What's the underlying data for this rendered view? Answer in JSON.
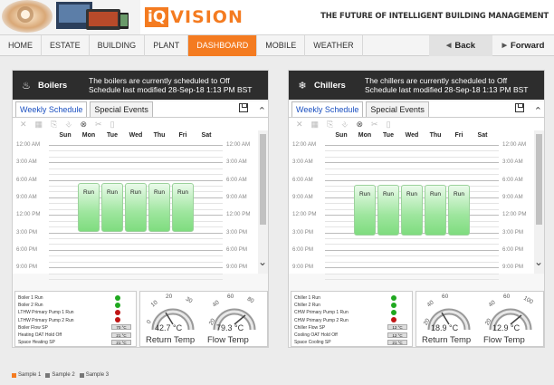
{
  "header": {
    "logo_iq": "iQ",
    "logo_vision": "VISION",
    "tagline": "THE FUTURE OF INTELLIGENT BUILDING MANAGEMENT"
  },
  "nav": {
    "items": [
      "HOME",
      "ESTATE",
      "BUILDING",
      "PLANT",
      "DASHBOARD",
      "MOBILE",
      "WEATHER"
    ],
    "active": "DASHBOARD",
    "back": "Back",
    "forward": "Forward"
  },
  "colors": {
    "accent": "#f47b20",
    "run": "#7fdc7f",
    "dark_header": "#2d2d2d"
  },
  "schedule_common": {
    "tabs": [
      "Weekly Schedule",
      "Special Events"
    ],
    "days": [
      "Sun",
      "Mon",
      "Tue",
      "Wed",
      "Thu",
      "Fri",
      "Sat"
    ],
    "times": [
      "12:00 AM",
      "3:00 AM",
      "6:00 AM",
      "9:00 AM",
      "12:00 PM",
      "3:00 PM",
      "6:00 PM",
      "9:00 PM"
    ],
    "run_label": "Run"
  },
  "boilers": {
    "title": "Boilers",
    "message_1": "The boilers are currently scheduled to Off",
    "message_2": "Schedule last modified 28-Sep-18 1:13 PM BST",
    "points": [
      {
        "label": "Boiler 1 Run",
        "status": "green"
      },
      {
        "label": "Boiler 2 Run",
        "status": "green"
      },
      {
        "label": "LTHW Primary Pump 1 Run",
        "status": "red"
      },
      {
        "label": "LTHW Primary Pump 2 Run",
        "status": "red"
      },
      {
        "label": "Boiler Flow SP",
        "value": "70 °C"
      },
      {
        "label": "Heating OAT Hold Off",
        "value": "21 °C"
      },
      {
        "label": "Space Heating SP",
        "value": "21 °C"
      }
    ],
    "gauges": [
      {
        "value": "42.7 °C",
        "caption": "Return Temp",
        "ticks": [
          "0",
          "10",
          "20",
          "30"
        ]
      },
      {
        "value": "79.3 °C",
        "caption": "Flow Temp",
        "ticks": [
          "20",
          "40",
          "60",
          "80"
        ]
      }
    ]
  },
  "chillers": {
    "title": "Chillers",
    "message_1": "The chillers are currently scheduled to Off",
    "message_2": "Schedule last modified 28-Sep-18 1:13 PM BST",
    "points": [
      {
        "label": "Chiller 1 Run",
        "status": "green"
      },
      {
        "label": "Chiller 2 Run",
        "status": "green"
      },
      {
        "label": "CHW Primary Pump 1 Run",
        "status": "green"
      },
      {
        "label": "CHW Primary Pump 2 Run",
        "status": "red"
      },
      {
        "label": "Chiller Flow SP",
        "value": "12 °C"
      },
      {
        "label": "Cooling OAT Hold Off",
        "value": "12 °C"
      },
      {
        "label": "Space Cooling SP",
        "value": "21 °C"
      }
    ],
    "gauges": [
      {
        "value": "18.9 °C",
        "caption": "Return Temp",
        "ticks": [
          "20",
          "40",
          "60"
        ]
      },
      {
        "value": "12.9 °C",
        "caption": "Flow Temp",
        "ticks": [
          "20",
          "40",
          "60",
          "100"
        ]
      }
    ]
  },
  "legend": [
    {
      "label": "Sample 1",
      "color": "#f47b20"
    },
    {
      "label": "Sample 2",
      "color": "#777777"
    },
    {
      "label": "Sample 3",
      "color": "#777777"
    }
  ]
}
